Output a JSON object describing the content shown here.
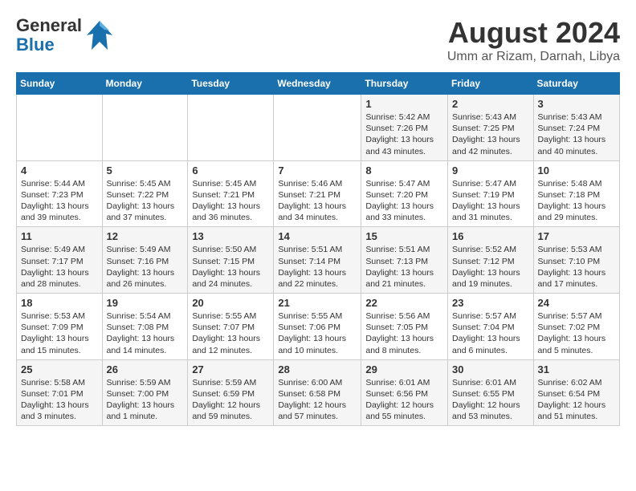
{
  "logo": {
    "line1": "General",
    "line2": "Blue"
  },
  "title": "August 2024",
  "location": "Umm ar Rizam, Darnah, Libya",
  "weekdays": [
    "Sunday",
    "Monday",
    "Tuesday",
    "Wednesday",
    "Thursday",
    "Friday",
    "Saturday"
  ],
  "weeks": [
    [
      {
        "day": "",
        "info": ""
      },
      {
        "day": "",
        "info": ""
      },
      {
        "day": "",
        "info": ""
      },
      {
        "day": "",
        "info": ""
      },
      {
        "day": "1",
        "info": "Sunrise: 5:42 AM\nSunset: 7:26 PM\nDaylight: 13 hours\nand 43 minutes."
      },
      {
        "day": "2",
        "info": "Sunrise: 5:43 AM\nSunset: 7:25 PM\nDaylight: 13 hours\nand 42 minutes."
      },
      {
        "day": "3",
        "info": "Sunrise: 5:43 AM\nSunset: 7:24 PM\nDaylight: 13 hours\nand 40 minutes."
      }
    ],
    [
      {
        "day": "4",
        "info": "Sunrise: 5:44 AM\nSunset: 7:23 PM\nDaylight: 13 hours\nand 39 minutes."
      },
      {
        "day": "5",
        "info": "Sunrise: 5:45 AM\nSunset: 7:22 PM\nDaylight: 13 hours\nand 37 minutes."
      },
      {
        "day": "6",
        "info": "Sunrise: 5:45 AM\nSunset: 7:21 PM\nDaylight: 13 hours\nand 36 minutes."
      },
      {
        "day": "7",
        "info": "Sunrise: 5:46 AM\nSunset: 7:21 PM\nDaylight: 13 hours\nand 34 minutes."
      },
      {
        "day": "8",
        "info": "Sunrise: 5:47 AM\nSunset: 7:20 PM\nDaylight: 13 hours\nand 33 minutes."
      },
      {
        "day": "9",
        "info": "Sunrise: 5:47 AM\nSunset: 7:19 PM\nDaylight: 13 hours\nand 31 minutes."
      },
      {
        "day": "10",
        "info": "Sunrise: 5:48 AM\nSunset: 7:18 PM\nDaylight: 13 hours\nand 29 minutes."
      }
    ],
    [
      {
        "day": "11",
        "info": "Sunrise: 5:49 AM\nSunset: 7:17 PM\nDaylight: 13 hours\nand 28 minutes."
      },
      {
        "day": "12",
        "info": "Sunrise: 5:49 AM\nSunset: 7:16 PM\nDaylight: 13 hours\nand 26 minutes."
      },
      {
        "day": "13",
        "info": "Sunrise: 5:50 AM\nSunset: 7:15 PM\nDaylight: 13 hours\nand 24 minutes."
      },
      {
        "day": "14",
        "info": "Sunrise: 5:51 AM\nSunset: 7:14 PM\nDaylight: 13 hours\nand 22 minutes."
      },
      {
        "day": "15",
        "info": "Sunrise: 5:51 AM\nSunset: 7:13 PM\nDaylight: 13 hours\nand 21 minutes."
      },
      {
        "day": "16",
        "info": "Sunrise: 5:52 AM\nSunset: 7:12 PM\nDaylight: 13 hours\nand 19 minutes."
      },
      {
        "day": "17",
        "info": "Sunrise: 5:53 AM\nSunset: 7:10 PM\nDaylight: 13 hours\nand 17 minutes."
      }
    ],
    [
      {
        "day": "18",
        "info": "Sunrise: 5:53 AM\nSunset: 7:09 PM\nDaylight: 13 hours\nand 15 minutes."
      },
      {
        "day": "19",
        "info": "Sunrise: 5:54 AM\nSunset: 7:08 PM\nDaylight: 13 hours\nand 14 minutes."
      },
      {
        "day": "20",
        "info": "Sunrise: 5:55 AM\nSunset: 7:07 PM\nDaylight: 13 hours\nand 12 minutes."
      },
      {
        "day": "21",
        "info": "Sunrise: 5:55 AM\nSunset: 7:06 PM\nDaylight: 13 hours\nand 10 minutes."
      },
      {
        "day": "22",
        "info": "Sunrise: 5:56 AM\nSunset: 7:05 PM\nDaylight: 13 hours\nand 8 minutes."
      },
      {
        "day": "23",
        "info": "Sunrise: 5:57 AM\nSunset: 7:04 PM\nDaylight: 13 hours\nand 6 minutes."
      },
      {
        "day": "24",
        "info": "Sunrise: 5:57 AM\nSunset: 7:02 PM\nDaylight: 13 hours\nand 5 minutes."
      }
    ],
    [
      {
        "day": "25",
        "info": "Sunrise: 5:58 AM\nSunset: 7:01 PM\nDaylight: 13 hours\nand 3 minutes."
      },
      {
        "day": "26",
        "info": "Sunrise: 5:59 AM\nSunset: 7:00 PM\nDaylight: 13 hours\nand 1 minute."
      },
      {
        "day": "27",
        "info": "Sunrise: 5:59 AM\nSunset: 6:59 PM\nDaylight: 12 hours\nand 59 minutes."
      },
      {
        "day": "28",
        "info": "Sunrise: 6:00 AM\nSunset: 6:58 PM\nDaylight: 12 hours\nand 57 minutes."
      },
      {
        "day": "29",
        "info": "Sunrise: 6:01 AM\nSunset: 6:56 PM\nDaylight: 12 hours\nand 55 minutes."
      },
      {
        "day": "30",
        "info": "Sunrise: 6:01 AM\nSunset: 6:55 PM\nDaylight: 12 hours\nand 53 minutes."
      },
      {
        "day": "31",
        "info": "Sunrise: 6:02 AM\nSunset: 6:54 PM\nDaylight: 12 hours\nand 51 minutes."
      }
    ]
  ]
}
